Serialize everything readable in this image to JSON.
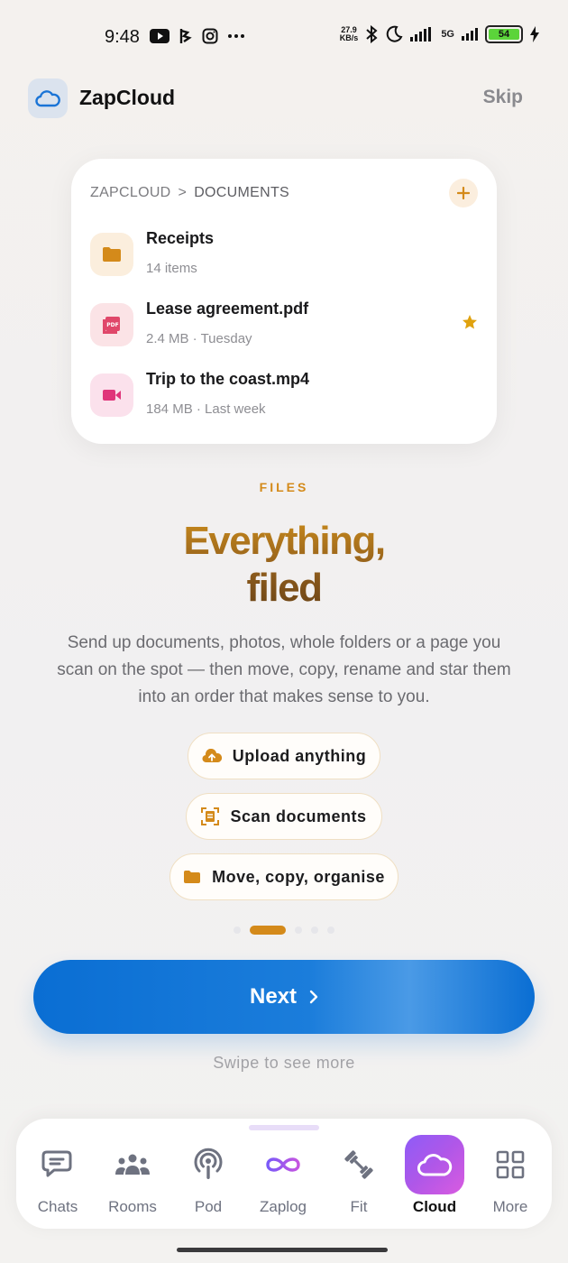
{
  "status_bar": {
    "time": "9:48",
    "net_speed_value": "27.9",
    "net_speed_unit": "KB/s",
    "network": "5G",
    "battery": "54",
    "icons": [
      "youtube-icon",
      "ev-icon",
      "instagram-icon",
      "more-dots-icon",
      "bluetooth-icon",
      "moon-icon",
      "signal-icon",
      "charging-icon"
    ]
  },
  "header": {
    "app_name": "ZapCloud",
    "skip_label": "Skip"
  },
  "preview": {
    "breadcrumb_root": "ZAPCLOUD",
    "breadcrumb_separator": ">",
    "breadcrumb_current": "DOCUMENTS",
    "files": [
      {
        "name": "Receipts",
        "meta": "14 items",
        "icon": "folder-icon",
        "starred": false
      },
      {
        "name": "Lease agreement.pdf",
        "meta": "2.4 MB · Tuesday",
        "icon": "pdf-icon",
        "starred": true
      },
      {
        "name": "Trip to the coast.mp4",
        "meta": "184 MB · Last week",
        "icon": "video-icon",
        "starred": false
      }
    ]
  },
  "content": {
    "eyebrow": "FILES",
    "headline_line1": "Everything,",
    "headline_line2": "filed",
    "description": "Send up documents, photos, whole folders or a page you scan on the spot — then move, copy, rename and star them into an order that makes sense to you."
  },
  "chips": [
    {
      "label": "Upload anything",
      "icon": "upload-cloud-icon"
    },
    {
      "label": "Scan documents",
      "icon": "scan-icon"
    },
    {
      "label": "Move, copy, organise",
      "icon": "folder-icon"
    }
  ],
  "pager": {
    "total": 6,
    "active_index": 1
  },
  "cta": {
    "next_label": "Next",
    "swipe_hint": "Swipe to see more"
  },
  "nav": {
    "items": [
      {
        "label": "Chats",
        "icon": "chat-icon",
        "active": false
      },
      {
        "label": "Rooms",
        "icon": "people-icon",
        "active": false
      },
      {
        "label": "Pod",
        "icon": "podcast-icon",
        "active": false
      },
      {
        "label": "Zaplog",
        "icon": "infinity-icon",
        "active": false
      },
      {
        "label": "Fit",
        "icon": "dumbbell-icon",
        "active": false
      },
      {
        "label": "Cloud",
        "icon": "cloud-icon",
        "active": true
      },
      {
        "label": "More",
        "icon": "grid-icon",
        "active": false
      }
    ]
  },
  "colors": {
    "accent_orange": "#d48a1a",
    "primary_blue": "#0a6ed3",
    "active_nav": "#a05af0"
  }
}
